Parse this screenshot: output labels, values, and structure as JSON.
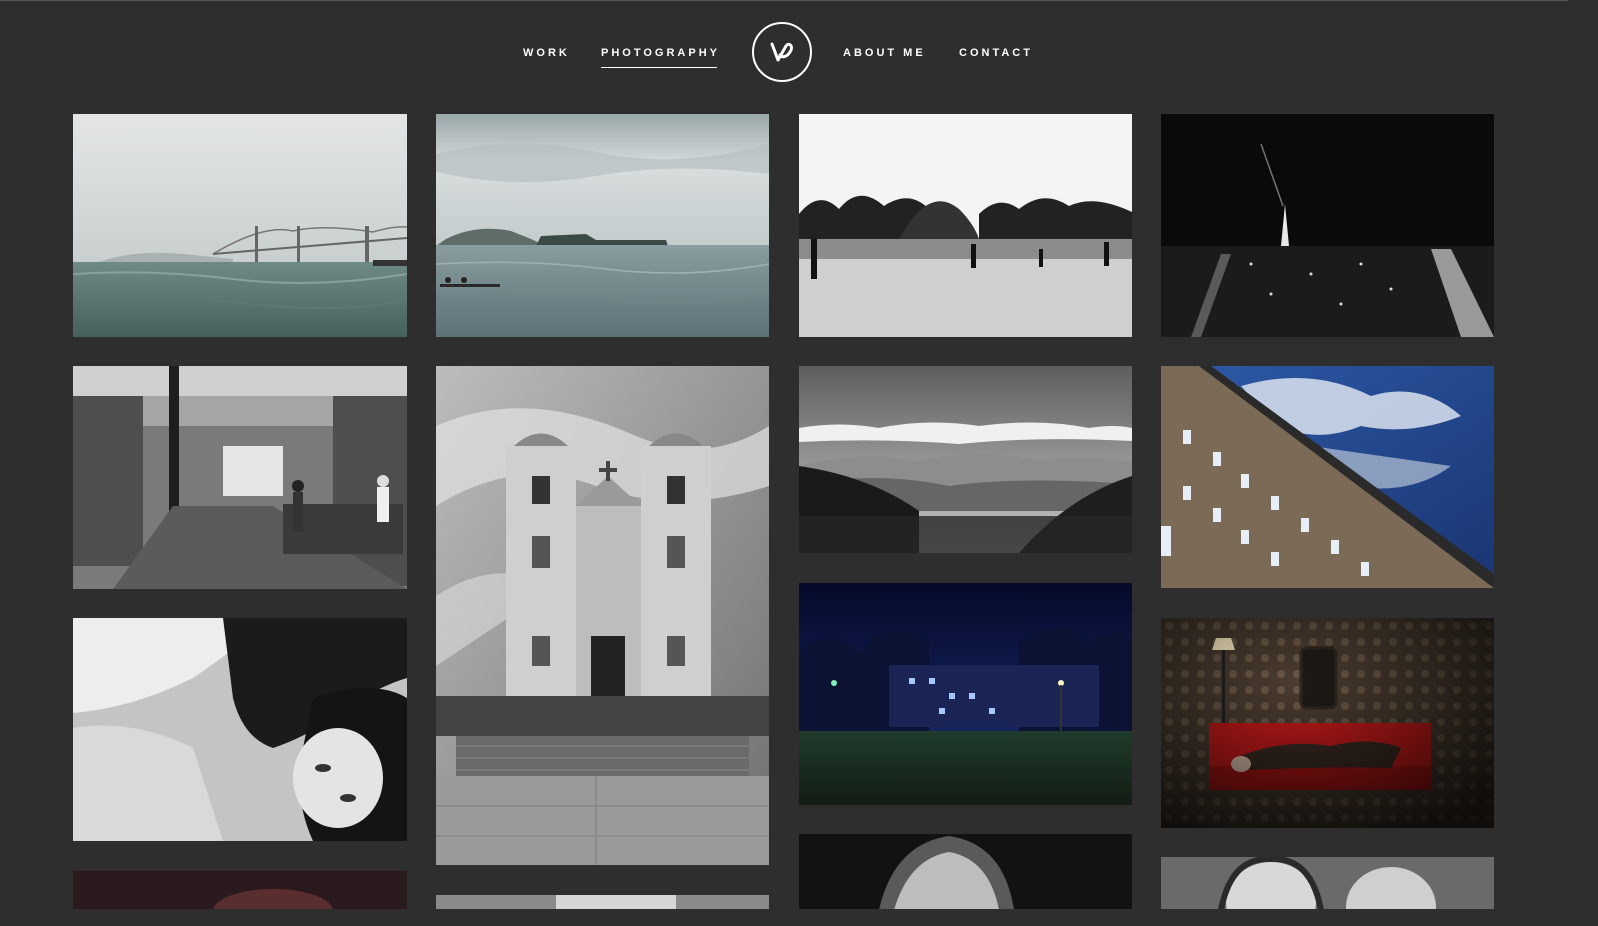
{
  "nav": {
    "left": [
      {
        "label": "WORK"
      },
      {
        "label": "PHOTOGRAPHY",
        "active": true
      }
    ],
    "right": [
      {
        "label": "ABOUT ME"
      },
      {
        "label": "CONTACT"
      }
    ],
    "logo_icon": "monogram-logo-icon"
  },
  "gallery": {
    "photos": [
      {
        "subject": "bay-bridge-over-water",
        "tone": "grayscale"
      },
      {
        "subject": "island-in-bay-with-rowers",
        "tone": "grayscale"
      },
      {
        "subject": "park-fountain-with-people",
        "tone": "black-and-white"
      },
      {
        "subject": "city-at-night-with-tower",
        "tone": "black-and-white"
      },
      {
        "subject": "shop-interior",
        "tone": "black-and-white"
      },
      {
        "subject": "tiled-church-facade",
        "tone": "black-and-white"
      },
      {
        "subject": "mountain-valley-landscape",
        "tone": "black-and-white"
      },
      {
        "subject": "brick-building-blue-sky",
        "tone": "color"
      },
      {
        "subject": "portrait-woman-lying-down",
        "tone": "black-and-white"
      },
      {
        "subject": "night-park-with-lamps",
        "tone": "color"
      },
      {
        "subject": "woman-on-red-sofa",
        "tone": "color"
      },
      {
        "subject": "portrait-partial",
        "tone": "color"
      },
      {
        "subject": "guitar-partial",
        "tone": "black-and-white"
      },
      {
        "subject": "portrait-dark-partial",
        "tone": "black-and-white"
      },
      {
        "subject": "two-women-portrait-partial",
        "tone": "black-and-white"
      }
    ]
  },
  "colors": {
    "background": "#2e2e2e",
    "nav_text": "#ffffff",
    "accent_red": "#c41a1a"
  }
}
